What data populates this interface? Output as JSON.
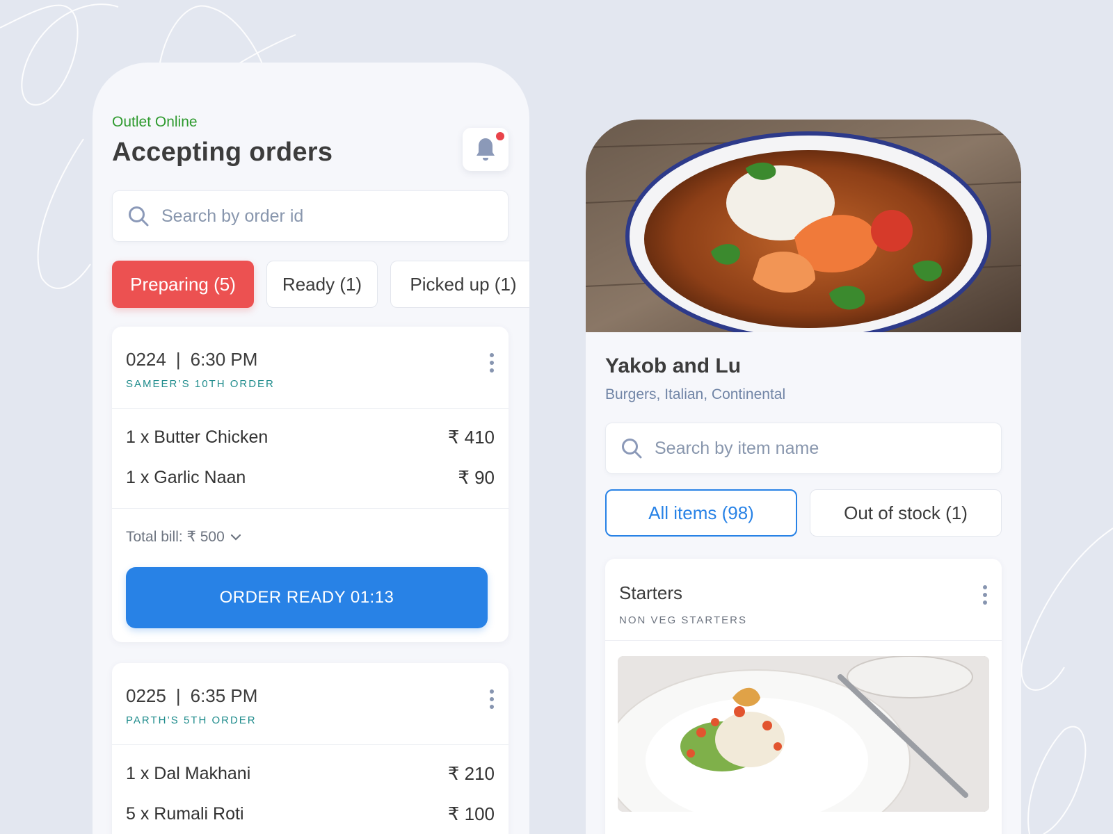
{
  "colors": {
    "background": "#e3e7f0",
    "online_green": "#2e9a2e",
    "accent_red": "#ec5151",
    "accent_blue": "#2882e6",
    "teal": "#1f8c8c",
    "notification_dot": "#e9434a"
  },
  "orders_screen": {
    "status": "Outlet Online",
    "title": "Accepting orders",
    "notification_icon": "bell-icon",
    "search": {
      "placeholder": "Search by order id",
      "icon": "search-icon"
    },
    "tabs": [
      {
        "label": "Preparing (5)",
        "active": true
      },
      {
        "label": "Ready (1)",
        "active": false
      },
      {
        "label": "Picked up (1)",
        "active": false
      }
    ],
    "orders": [
      {
        "id": "0224",
        "separator": "|",
        "time": "6:30 PM",
        "subtitle": "SAMEER’S 10TH ORDER",
        "items": [
          {
            "name": "1 x Butter Chicken",
            "price": "₹ 410"
          },
          {
            "name": "1 x Garlic Naan",
            "price": "₹ 90"
          }
        ],
        "total": "Total bill: ₹ 500",
        "action": "ORDER READY 01:13"
      },
      {
        "id": "0225",
        "separator": "|",
        "time": "6:35 PM",
        "subtitle": "PARTH’S 5TH ORDER",
        "items": [
          {
            "name": "1 x Dal Makhani",
            "price": "₹ 210"
          },
          {
            "name": "5 x Rumali Roti",
            "price": "₹ 100"
          }
        ]
      }
    ]
  },
  "menu_screen": {
    "restaurant_name": "Yakob and Lu",
    "cuisines": "Burgers, Italian, Continental",
    "search": {
      "placeholder": "Search by item name",
      "icon": "search-icon"
    },
    "tabs": [
      {
        "label": "All items (98)",
        "active": true
      },
      {
        "label": "Out of stock (1)",
        "active": false
      }
    ],
    "category": {
      "title": "Starters",
      "subtitle": "NON VEG STARTERS"
    }
  }
}
